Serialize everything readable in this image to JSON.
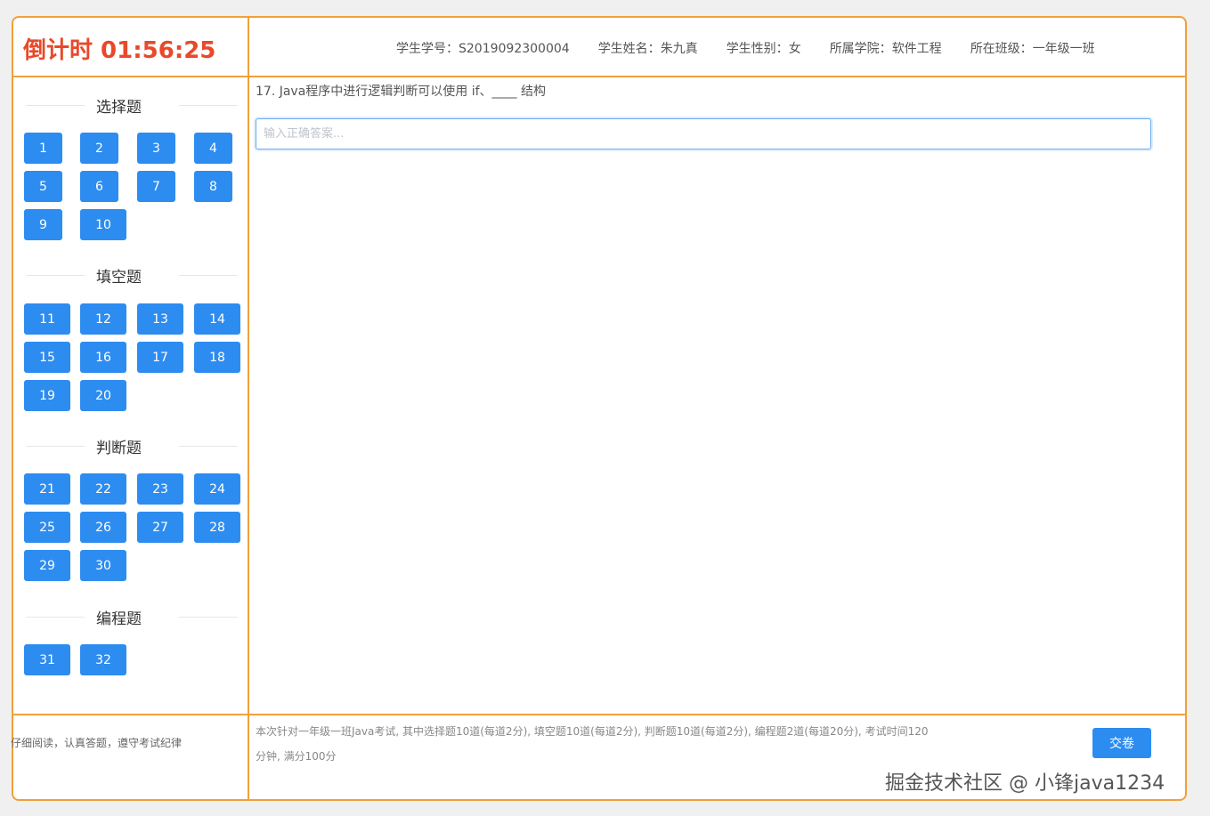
{
  "header": {
    "timer": "倒计时 01:56:25",
    "info": [
      {
        "key": "学生学号：",
        "value": "S2019092300004"
      },
      {
        "key": "学生姓名：",
        "value": "朱九真"
      },
      {
        "key": "学生性别：",
        "value": "女"
      },
      {
        "key": "所属学院：",
        "value": "软件工程"
      },
      {
        "key": "所在班级：",
        "value": "一年级一班"
      }
    ]
  },
  "sidebar": {
    "sections": [
      {
        "title": "选择题",
        "numbers": [
          "1",
          "2",
          "3",
          "4",
          "5",
          "6",
          "7",
          "8",
          "9",
          "10"
        ]
      },
      {
        "title": "填空题",
        "numbers": [
          "11",
          "12",
          "13",
          "14",
          "15",
          "16",
          "17",
          "18",
          "19",
          "20"
        ]
      },
      {
        "title": "判断题",
        "numbers": [
          "21",
          "22",
          "23",
          "24",
          "25",
          "26",
          "27",
          "28",
          "29",
          "30"
        ]
      },
      {
        "title": "编程题",
        "numbers": [
          "31",
          "32"
        ]
      }
    ]
  },
  "main": {
    "question": "17. Java程序中进行逻辑判断可以使用 if、____ 结构",
    "answer_placeholder": "输入正确答案...",
    "answer_value": ""
  },
  "footer": {
    "notice": "仔细阅读，认真答题，遵守考试纪律",
    "description": "本次针对一年级一班Java考试, 其中选择题10道(每道2分), 填空题10道(每道2分), 判断题10道(每道2分), 编程题2道(每道20分), 考试时间120分钟, 满分100分",
    "submit_label": "交卷"
  },
  "watermark": "掘金技术社区 @ 小锋java1234",
  "colors": {
    "accent": "#2d8cf0",
    "border": "#f0a13a",
    "timer": "#e8492a"
  }
}
